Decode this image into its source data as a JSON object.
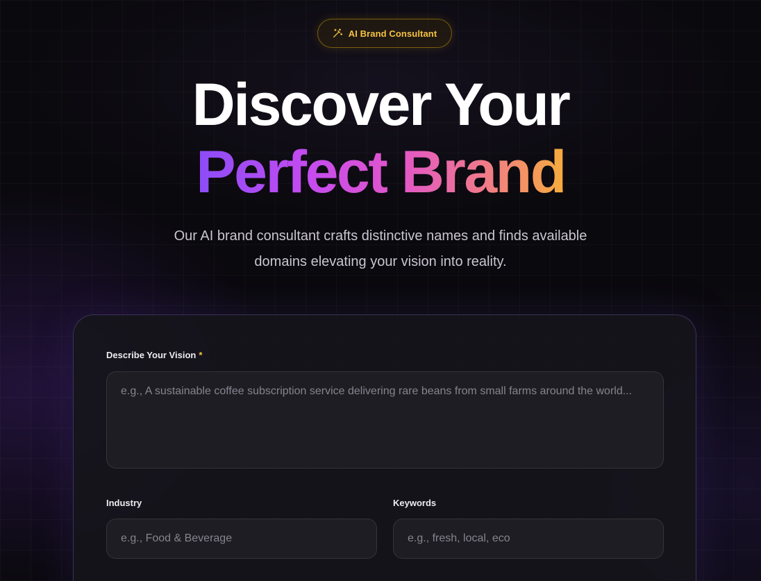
{
  "badge": {
    "icon": "magic-wand-icon",
    "label": "AI Brand Consultant",
    "color": "#f5c242"
  },
  "hero": {
    "line1": "Discover Your",
    "line2": "Perfect Brand",
    "gradient": [
      "#8b4cf7",
      "#c44bf0",
      "#e256c9",
      "#f07a8a",
      "#f7ad3c"
    ]
  },
  "subtitle": {
    "line1": "Our AI brand consultant crafts distinctive names and finds available",
    "line2": "domains elevating your vision into reality."
  },
  "form": {
    "vision": {
      "label": "Describe Your Vision",
      "required_mark": "*",
      "value": "",
      "placeholder": "e.g., A sustainable coffee subscription service delivering rare beans from small farms around the world..."
    },
    "industry": {
      "label": "Industry",
      "value": "",
      "placeholder": "e.g., Food & Beverage"
    },
    "keywords": {
      "label": "Keywords",
      "value": "",
      "placeholder": "e.g., fresh, local, eco"
    }
  }
}
